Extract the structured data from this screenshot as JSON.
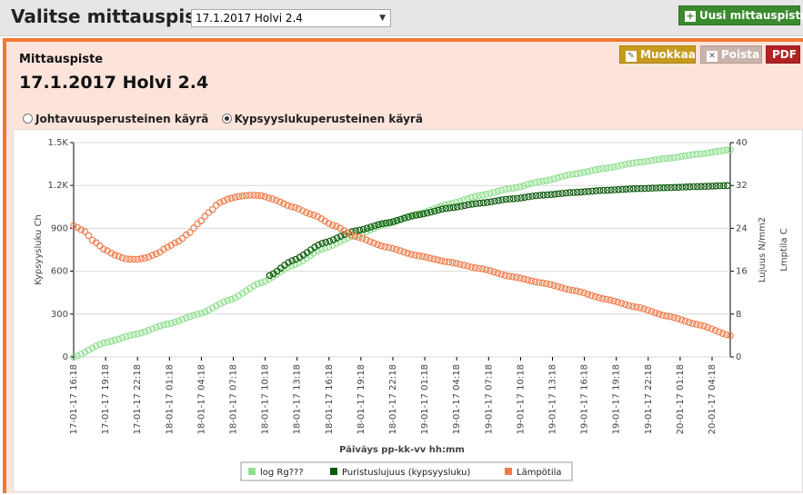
{
  "header": {
    "title": "Valitse mittauspiste:",
    "select_value": "17.1.2017 Holvi 2.4",
    "new_button": "Uusi mittauspiste"
  },
  "panel": {
    "section_label": "Mittauspiste",
    "title": "17.1.2017 Holvi 2.4",
    "buttons": {
      "edit": "Muokkaa",
      "delete": "Poista",
      "pdf": "PDF"
    },
    "radios": [
      {
        "label": "Johtavuusperusteinen käyrä",
        "selected": false
      },
      {
        "label": "Kypsyyslukuperusteinen käyrä",
        "selected": true
      }
    ]
  },
  "colors": {
    "accent": "#f07830",
    "green_btn": "#3a8a2e",
    "series_light": "#8fe08f",
    "series_dark": "#0b5a0b",
    "series_orange": "#f07c4a"
  },
  "chart_data": {
    "type": "scatter",
    "xlabel": "Päiväys pp-kk-vv hh:mm",
    "ylabel_left": "Kypsyysluku Ch",
    "ylabel_right_1": "Lujuus N/mm2",
    "ylabel_right_2": "Lmptila C",
    "y_left": {
      "min": 0,
      "max": 1500,
      "ticks": [
        "0",
        "300",
        "600",
        "900",
        "1.2K",
        "1.5K"
      ]
    },
    "y_right": {
      "min": 0,
      "max": 40,
      "ticks": [
        "0",
        "8",
        "16",
        "24",
        "32",
        "40"
      ]
    },
    "x_ticks": [
      "17-01-17 16:18",
      "17-01-17 19:18",
      "17-01-17 22:18",
      "18-01-17 01:18",
      "18-01-17 04:18",
      "18-01-17 07:18",
      "18-01-17 10:18",
      "18-01-17 13:18",
      "18-01-17 16:18",
      "18-01-17 19:18",
      "18-01-17 22:18",
      "19-01-17 01:18",
      "19-01-17 04:18",
      "19-01-17 07:18",
      "19-01-17 10:18",
      "19-01-17 13:18",
      "19-01-17 16:18",
      "19-01-17 19:18",
      "19-01-17 22:18",
      "20-01-17 01:18",
      "20-01-17 04:18"
    ],
    "x_range_hours": [
      0,
      63
    ],
    "series": [
      {
        "name": "log Rg???",
        "axis": "left",
        "color": "#8fe08f",
        "points": [
          [
            0,
            0
          ],
          [
            3,
            100
          ],
          [
            6,
            160
          ],
          [
            9,
            230
          ],
          [
            12,
            300
          ],
          [
            15,
            400
          ],
          [
            18,
            520
          ],
          [
            21,
            640
          ],
          [
            24,
            760
          ],
          [
            27,
            850
          ],
          [
            30,
            930
          ],
          [
            33,
            1000
          ],
          [
            36,
            1070
          ],
          [
            39,
            1130
          ],
          [
            42,
            1180
          ],
          [
            45,
            1230
          ],
          [
            48,
            1280
          ],
          [
            51,
            1320
          ],
          [
            54,
            1360
          ],
          [
            57,
            1390
          ],
          [
            60,
            1420
          ],
          [
            63,
            1450
          ]
        ]
      },
      {
        "name": "Puristuslujuus (kypsyysluku)",
        "axis": "right",
        "color": "#0b5a0b",
        "start_hour": 18.8,
        "points": [
          [
            18.8,
            15.2
          ],
          [
            21,
            18
          ],
          [
            24,
            21.3
          ],
          [
            27,
            23.5
          ],
          [
            30,
            25
          ],
          [
            33,
            26.5
          ],
          [
            36,
            27.8
          ],
          [
            39,
            28.7
          ],
          [
            42,
            29.5
          ],
          [
            45,
            30.2
          ],
          [
            48,
            30.7
          ],
          [
            51,
            31.1
          ],
          [
            54,
            31.4
          ],
          [
            57,
            31.6
          ],
          [
            60,
            31.8
          ],
          [
            63,
            32
          ]
        ]
      },
      {
        "name": "Lämpötila",
        "axis": "right",
        "color": "#f07c4a",
        "points": [
          [
            0,
            24.5
          ],
          [
            1,
            23.5
          ],
          [
            2,
            21.5
          ],
          [
            3,
            20
          ],
          [
            4,
            19
          ],
          [
            5,
            18.3
          ],
          [
            6,
            18.2
          ],
          [
            7,
            18.5
          ],
          [
            8,
            19.3
          ],
          [
            9,
            20.5
          ],
          [
            10,
            21.5
          ],
          [
            11,
            23
          ],
          [
            12,
            25
          ],
          [
            13,
            27
          ],
          [
            14,
            28.8
          ],
          [
            15,
            29.6
          ],
          [
            16,
            30
          ],
          [
            17,
            30.2
          ],
          [
            18,
            30.1
          ],
          [
            19,
            29.5
          ],
          [
            21,
            28
          ],
          [
            23,
            26.5
          ],
          [
            25,
            24.5
          ],
          [
            27,
            22.5
          ],
          [
            30,
            20.5
          ],
          [
            33,
            18.9
          ],
          [
            36,
            17.7
          ],
          [
            39,
            16.5
          ],
          [
            42,
            15
          ],
          [
            45,
            13.8
          ],
          [
            48,
            12.4
          ],
          [
            51,
            10.8
          ],
          [
            54,
            9.3
          ],
          [
            57,
            7.6
          ],
          [
            60,
            6
          ],
          [
            63,
            4
          ]
        ]
      }
    ],
    "legend": [
      "log Rg???",
      "Puristuslujuus (kypsyysluku)",
      "Lämpötila"
    ],
    "legend_position": "bottom-center",
    "grid": true
  }
}
